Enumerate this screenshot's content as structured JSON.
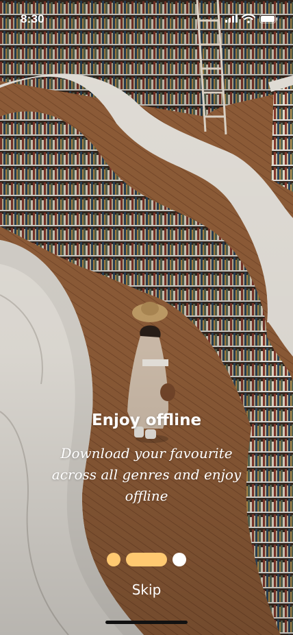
{
  "status_bar": {
    "time": "8:30",
    "icons": [
      "cellular-signal-icon",
      "wifi-icon",
      "battery-icon"
    ]
  },
  "onboarding": {
    "title": "Enjoy offline",
    "description": "Download your favourite across all genres and enjoy offline",
    "page_count": 3,
    "active_page": 2
  },
  "actions": {
    "skip_label": "Skip"
  },
  "colors": {
    "accent": "#ffc971",
    "dot_inactive": "#ffffff",
    "floor": "#8c5a33",
    "shelf": "#ece8e1"
  }
}
